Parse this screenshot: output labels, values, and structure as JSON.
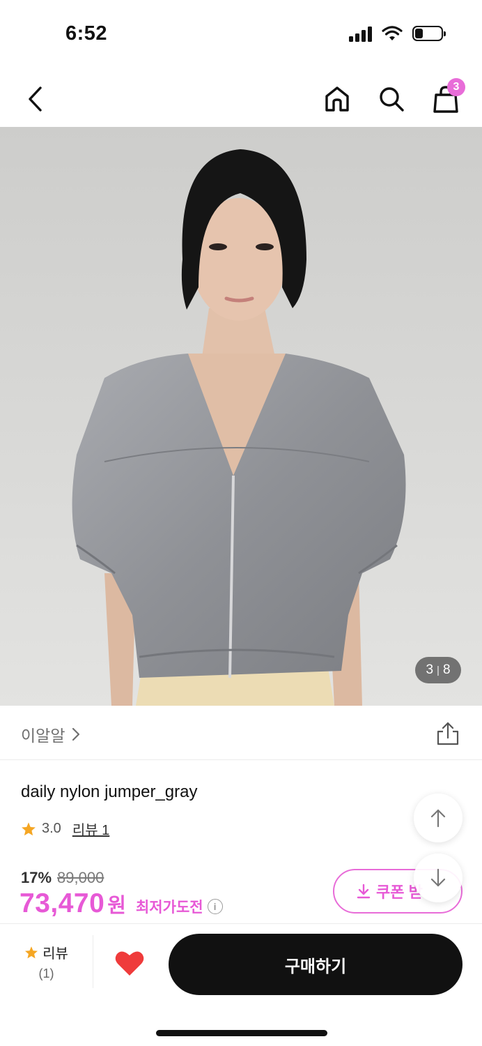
{
  "status_bar": {
    "time": "6:52"
  },
  "nav": {
    "cart_count": "3"
  },
  "image": {
    "current": "3",
    "total": "8"
  },
  "brand": {
    "name": "이알알"
  },
  "product": {
    "title": "daily nylon jumper_gray",
    "rating": "3.0",
    "review_link": "리뷰 1",
    "discount_pct": "17%",
    "original_price": "89,000",
    "price": "73,470",
    "currency": "원",
    "lowest_label": "최저가도전",
    "coupon_label": "쿠폰 받"
  },
  "bottom_bar": {
    "review_label": "리뷰",
    "review_count": "(1)",
    "buy_label": "구매하기"
  },
  "colors": {
    "accent": "#e759d6",
    "star": "#f5a623",
    "heart": "#ef3b3b",
    "buy_bg": "#111111"
  }
}
